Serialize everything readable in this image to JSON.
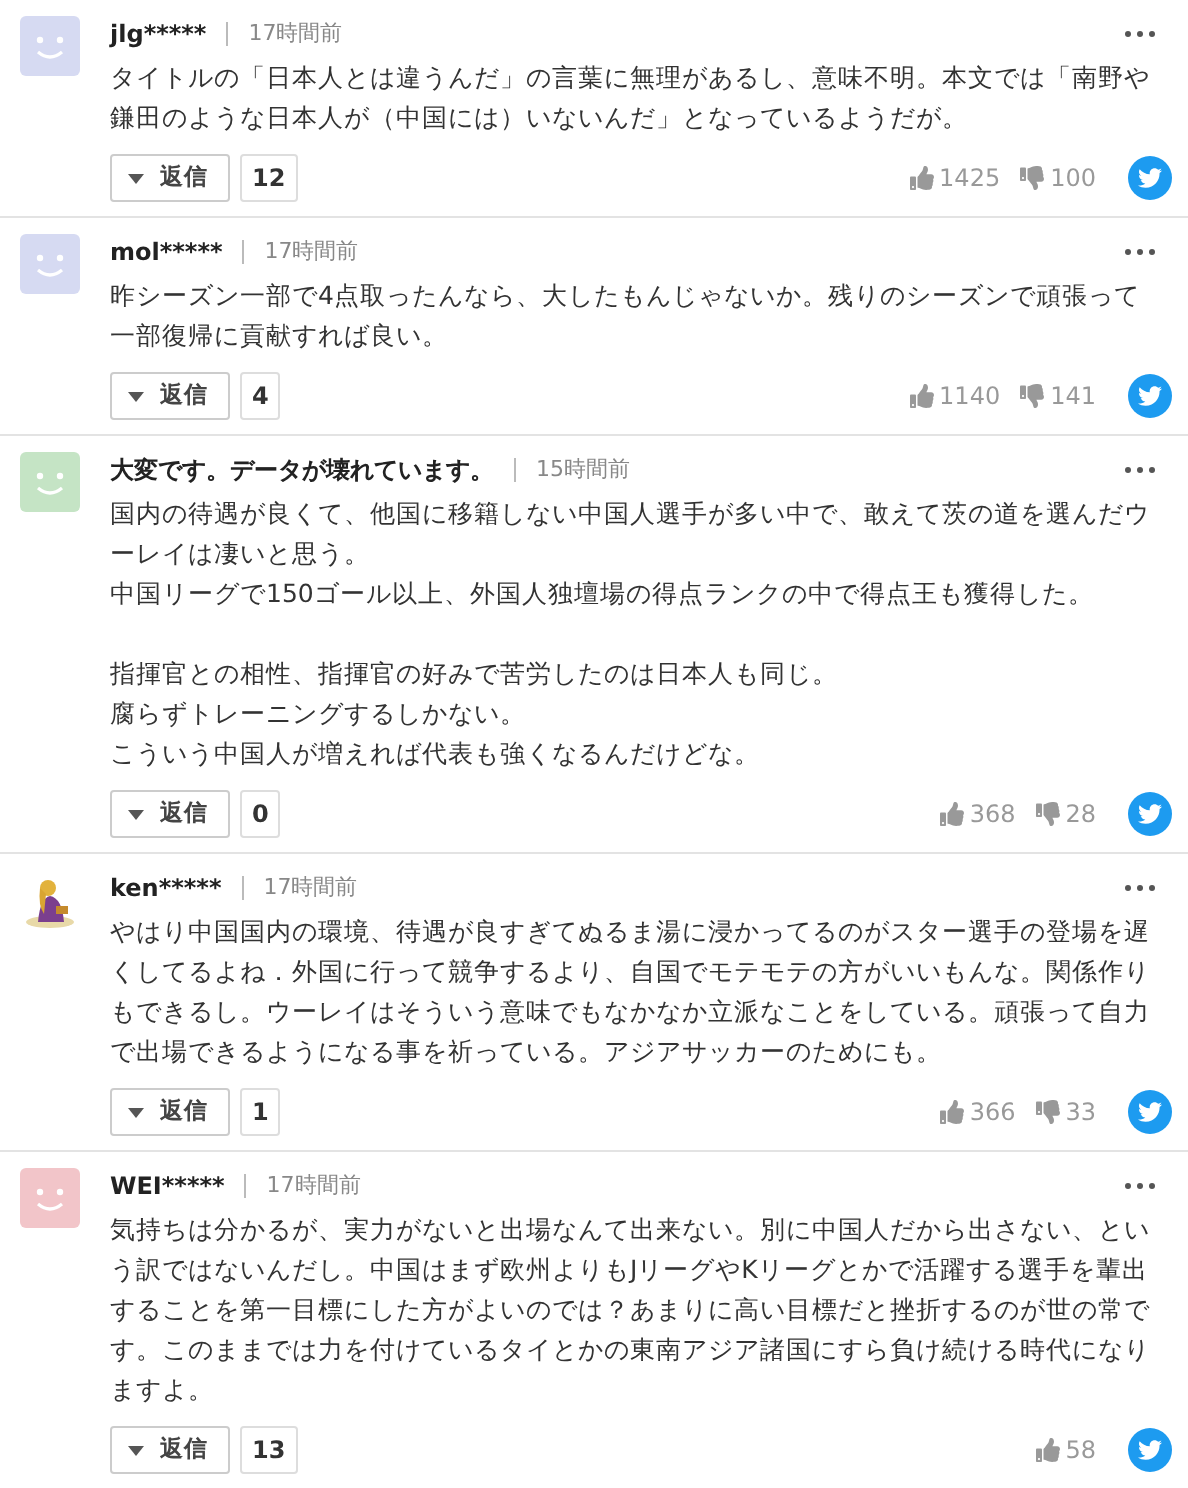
{
  "comments": [
    {
      "avatar": {
        "kind": "smiley",
        "color": "#d6daf2"
      },
      "name": "jlg*****",
      "time": "17時間前",
      "paragraphs": [
        [
          "タイトルの「日本人とは違うんだ」の言葉に無理があるし、意味不明。本文では「南野や鎌田のような日本人が（中国には）いないんだ」となっているようだが。"
        ]
      ],
      "reply_label": "返信",
      "reply_count": "12",
      "likes": "1425",
      "dislikes": "100"
    },
    {
      "avatar": {
        "kind": "smiley",
        "color": "#d6daf2"
      },
      "name": "mol*****",
      "time": "17時間前",
      "paragraphs": [
        [
          "昨シーズン一部で4点取ったんなら、大したもんじゃないか。残りのシーズンで頑張って一部復帰に貢献すれば良い。"
        ]
      ],
      "reply_label": "返信",
      "reply_count": "4",
      "likes": "1140",
      "dislikes": "141"
    },
    {
      "avatar": {
        "kind": "smiley",
        "color": "#c5e4c5"
      },
      "name": "大変です。データが壊れています。",
      "time": "15時間前",
      "paragraphs": [
        [
          "国内の待遇が良くて、他国に移籍しない中国人選手が多い中で、敢えて茨の道を選んだウーレイは凄いと思う。",
          "中国リーグで150ゴール以上、外国人独壇場の得点ランクの中で得点王も獲得した。"
        ],
        [
          "指揮官との相性、指揮官の好みで苦労したのは日本人も同じ。",
          "腐らずトレーニングするしかない。",
          "こういう中国人が増えれば代表も強くなるんだけどな。"
        ]
      ],
      "reply_label": "返信",
      "reply_count": "0",
      "likes": "368",
      "dislikes": "28"
    },
    {
      "avatar": {
        "kind": "picture"
      },
      "name": "ken*****",
      "time": "17時間前",
      "paragraphs": [
        [
          "やはり中国国内の環境、待遇が良すぎてぬるま湯に浸かってるのがスター選手の登場を遅くしてるよね．外国に行って競争するより、自国でモテモテの方がいいもんな。関係作りもできるし。ウーレイはそういう意味でもなかなか立派なことをしている。頑張って自力で出場できるようになる事を祈っている。アジアサッカーのためにも。"
        ]
      ],
      "reply_label": "返信",
      "reply_count": "1",
      "likes": "366",
      "dislikes": "33"
    },
    {
      "avatar": {
        "kind": "smiley",
        "color": "#f2c5c9"
      },
      "name": "WEI*****",
      "time": "17時間前",
      "paragraphs": [
        [
          "気持ちは分かるが、実力がないと出場なんて出来ない。別に中国人だから出さない、という訳ではないんだし。中国はまず欧州よりもJリーグやKリーグとかで活躍する選手を輩出することを第一目標にした方がよいのでは？あまりに高い目標だと挫折するのが世の常です。このままでは力を付けているタイとかの東南アジア諸国にすら負け続ける時代になりますよ。"
        ]
      ],
      "reply_label": "返信",
      "reply_count": "13",
      "likes": "58"
    }
  ]
}
